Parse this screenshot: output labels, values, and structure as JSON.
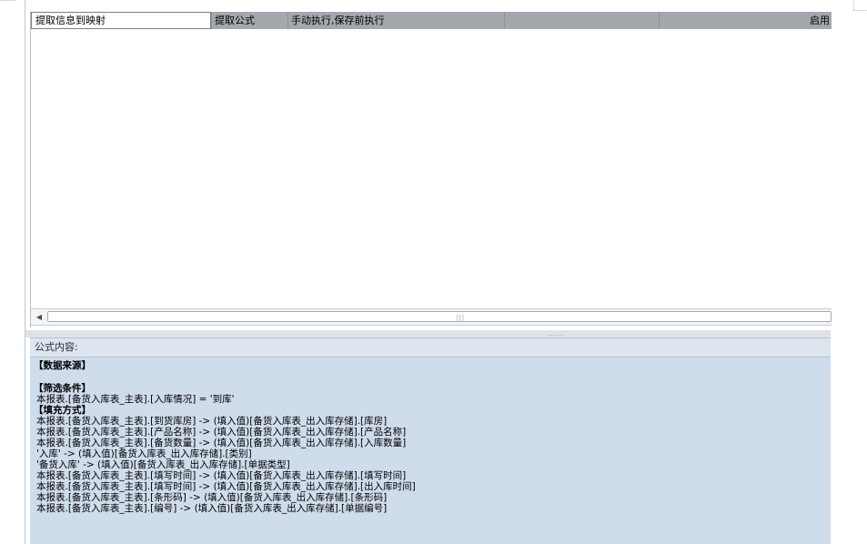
{
  "grid": {
    "columns": [
      {
        "label": "提取信息到映射"
      },
      {
        "label": "提取公式"
      },
      {
        "label": "手动执行,保存前执行"
      },
      {
        "label": ""
      },
      {
        "label": ""
      },
      {
        "label": "启用"
      }
    ],
    "scroll_grip": "|||"
  },
  "splitter": {
    "grip": "....."
  },
  "formula": {
    "title": "公式内容:",
    "lines": [
      "【数据来源】",
      "",
      "【筛选条件】",
      "本报表.[备货入库表_主表].[入库情况] = '到库'",
      "【填充方式】",
      "本报表.[备货入库表_主表].[到货库房]   -> (填入值)[备货入库表_出入库存储].[库房]",
      "本报表.[备货入库表_主表].[产品名称]   -> (填入值)[备货入库表_出入库存储].[产品名称]",
      "本报表.[备货入库表_主表].[备货数量]   -> (填入值)[备货入库表_出入库存储].[入库数量]",
      "'入库'   -> (填入值)[备货入库表_出入库存储].[类别]",
      "'备货入库'   -> (填入值)[备货入库表_出入库存储].[单据类型]",
      "本报表.[备货入库表_主表].[填写时间]   -> (填入值)[备货入库表_出入库存储].[填写时间]",
      "本报表.[备货入库表_主表].[填写时间]   -> (填入值)[备货入库表_出入库存储].[出入库时间]",
      "本报表.[备货入库表_主表].[条形码]   -> (填入值)[备货入库表_出入库存储].[条形码]",
      "本报表.[备货入库表_主表].[编号]   -> (填入值)[备货入库表_出入库存储].[单据编号]"
    ]
  }
}
